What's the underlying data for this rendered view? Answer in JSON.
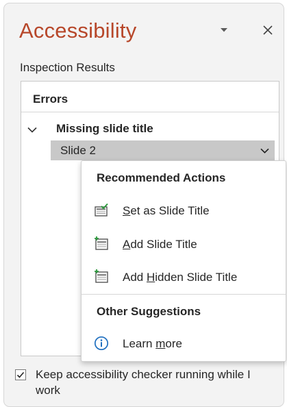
{
  "pane": {
    "title": "Accessibility"
  },
  "inspection": {
    "label": "Inspection Results"
  },
  "errors": {
    "section_label": "Errors",
    "groups": [
      {
        "label": "Missing slide title",
        "items": [
          {
            "label": "Slide 2"
          }
        ]
      }
    ]
  },
  "actions_menu": {
    "recommended_heading": "Recommended Actions",
    "items": [
      {
        "label": "Set as Slide Title",
        "pre": "",
        "accel": "S",
        "post": "et as Slide Title",
        "icon": "set-slide-title-icon"
      },
      {
        "label": "Add Slide Title",
        "pre": "",
        "accel": "A",
        "post": "dd Slide Title",
        "icon": "add-slide-title-icon"
      },
      {
        "label": "Add Hidden Slide Title",
        "pre": "Add ",
        "accel": "H",
        "post": "idden Slide Title",
        "icon": "add-hidden-slide-title-icon"
      }
    ],
    "other_heading": "Other Suggestions",
    "learn_more": {
      "label": "Learn more",
      "pre": "Learn ",
      "accel": "m",
      "post": "ore",
      "icon": "info-icon"
    }
  },
  "keep_running": {
    "label": "Keep accessibility checker running while I work",
    "checked": true
  },
  "colors": {
    "title": "#b7472a",
    "info": "#1f6fbf",
    "pane_bg": "#f3f3f3",
    "selected_row": "#c8c8c8"
  }
}
